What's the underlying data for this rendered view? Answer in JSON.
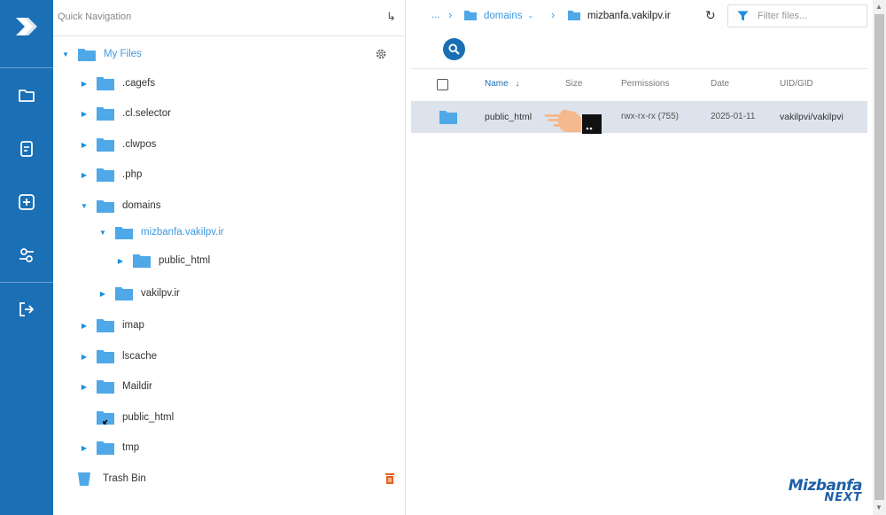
{
  "sidebar_rail": {
    "icons": [
      "app-logo-icon",
      "folder-icon",
      "document-icon",
      "add-icon",
      "settings-sliders-icon",
      "logout-icon"
    ]
  },
  "quick_nav": {
    "title": "Quick Navigation",
    "root_label": "My Files",
    "items": [
      {
        "label": ".cagefs"
      },
      {
        "label": ".cl.selector"
      },
      {
        "label": ".clwpos"
      },
      {
        "label": ".php"
      },
      {
        "label": "domains"
      },
      {
        "label": "mizbanfa.vakilpv.ir"
      },
      {
        "label": "public_html"
      },
      {
        "label": "vakilpv.ir"
      },
      {
        "label": "imap"
      },
      {
        "label": "lscache"
      },
      {
        "label": "Maildir"
      },
      {
        "label": "public_html"
      },
      {
        "label": "tmp"
      }
    ],
    "trash_label": "Trash Bin"
  },
  "breadcrumb": {
    "ellipsis": "...",
    "parent": "domains",
    "current": "mizbanfa.vakilpv.ir"
  },
  "filter": {
    "placeholder": "Filter files..."
  },
  "table": {
    "headers": {
      "name": "Name",
      "size": "Size",
      "permissions": "Permissions",
      "date": "Date",
      "uid": "UID/GID"
    },
    "rows": [
      {
        "name": "public_html",
        "size": "",
        "permissions": "rwx-rx-rx (755)",
        "date": "2025-01-11",
        "uid": "vakilpvi/vakilpvi"
      }
    ]
  },
  "brand": {
    "line1": "Mizbanfa",
    "line2": "NEXT"
  },
  "colors": {
    "rail": "#1a6fb5",
    "folder": "#4fa8e8",
    "accent": "#3c9ae0",
    "selected_row": "#dde3ec"
  }
}
